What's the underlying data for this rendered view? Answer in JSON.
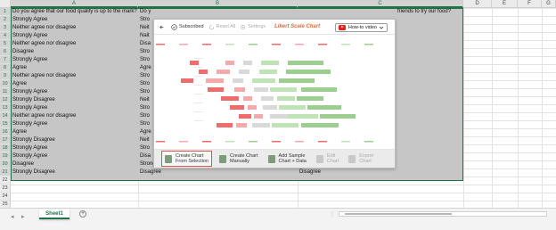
{
  "columns": [
    "A",
    "B",
    "C",
    "D",
    "E",
    "F",
    "G"
  ],
  "rows": [
    "1",
    "2",
    "3",
    "4",
    "5",
    "6",
    "7",
    "8",
    "9",
    "10",
    "11",
    "12",
    "13",
    "14",
    "15",
    "16",
    "17",
    "18",
    "19",
    "20",
    "21",
    "22",
    "23",
    "24",
    "25"
  ],
  "header_cells": {
    "a1": "Do you agree that our food quality is up to the mark?",
    "b1": "Do y",
    "c1": "friends to try our food?"
  },
  "col_a": [
    "Strongly Agree",
    "Neither agree nor disagree",
    "Strongly Agree",
    "Neither agree nor disagree",
    "Disagree",
    "Strongly Agree",
    "Agree",
    "Neither agree nor disagree",
    "Agree",
    "Strongly Agree",
    "Strongly Disagree",
    "Strongly Agree",
    "Neither agree nor disagree",
    "Strongly Agree",
    "Agree",
    "Strongly Disagree",
    "Strongly Agree",
    "Strongly Agree",
    "Disagree",
    "Strongly Disagree"
  ],
  "col_b": [
    "Stro",
    "Neit",
    "Nait",
    "Disa",
    "Stro",
    "Stro",
    "Agre",
    "Stro",
    "Stro",
    "Stro",
    "Neit",
    "Stro",
    "Stro",
    "Stro",
    "Agre",
    "Neit",
    "Stro",
    "Disa",
    "Strongly Agree",
    "Disagree"
  ],
  "col_c": [
    "",
    "",
    "",
    "",
    "",
    "",
    "",
    "",
    "",
    "",
    "",
    "",
    "",
    "",
    "",
    "",
    "",
    "",
    "Strongly Agree",
    "Disagree"
  ],
  "toolbar": {
    "subscribed": "Subscribed",
    "reset_all": "Reset All",
    "settings": "Settings",
    "chart_title": "Likert Scale Chart",
    "howto": "How-to video"
  },
  "actions": {
    "create_selection_1": "Create Chart",
    "create_selection_2": "From Selection",
    "create_manual_1": "Create Chart",
    "create_manual_2": "Manually",
    "add_sample_1": "Add Sample",
    "add_sample_2": "Chart + Data",
    "edit_1": "Edit",
    "edit_2": "Chart",
    "export_1": "Export",
    "export_2": "Chart"
  },
  "sheet": {
    "tab": "Sheet1",
    "add": "+"
  },
  "colors": {
    "accent": "#217346",
    "title": "#e06b3a",
    "neg_strong": "#f06b6b",
    "neg": "#f4aaaa",
    "neutral": "#d9d9d9",
    "pos": "#bfe3b5",
    "pos_strong": "#9ccf8f"
  }
}
